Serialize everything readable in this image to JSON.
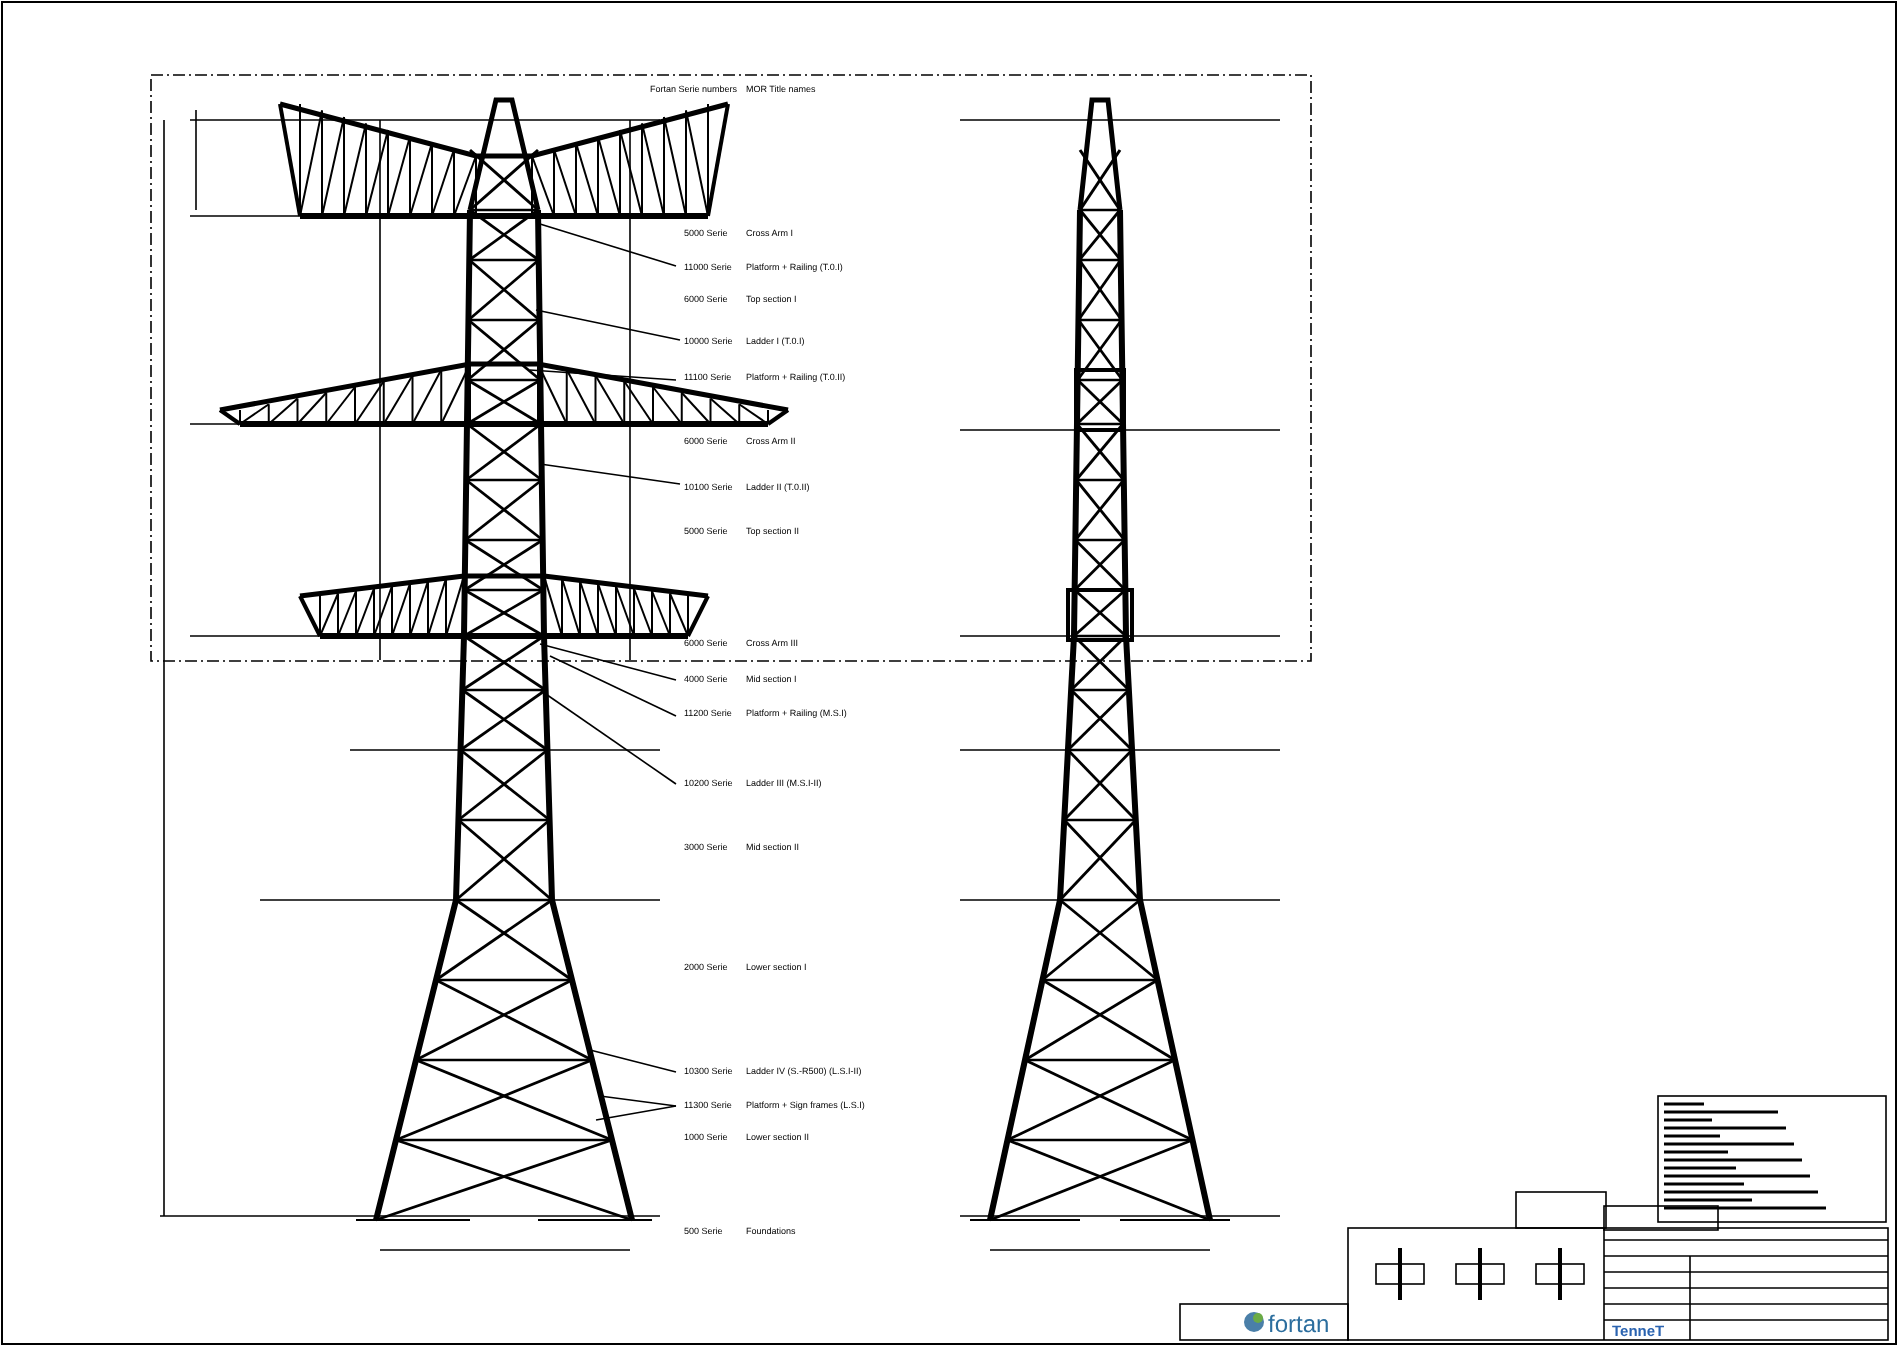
{
  "legend": {
    "headings": [
      "Fortan Serie numbers",
      "MOR Title names"
    ],
    "parts": [
      {
        "serie": "5000 Serie",
        "name": "Cross Arm I"
      },
      {
        "serie": "11000 Serie",
        "name": "Platform + Railing (T.0.I)"
      },
      {
        "serie": "6000 Serie",
        "name": "Top section I"
      },
      {
        "serie": "10000 Serie",
        "name": "Ladder I (T.0.I)"
      },
      {
        "serie": "11100 Serie",
        "name": "Platform + Railing (T.0.II)"
      },
      {
        "serie": "6000 Serie",
        "name": "Cross Arm II"
      },
      {
        "serie": "10100 Serie",
        "name": "Ladder II (T.0.II)"
      },
      {
        "serie": "5000 Serie",
        "name": "Top section II"
      },
      {
        "serie": "6000 Serie",
        "name": "Cross Arm III"
      },
      {
        "serie": "4000 Serie",
        "name": "Mid section I"
      },
      {
        "serie": "11200 Serie",
        "name": "Platform + Railing (M.S.I)"
      },
      {
        "serie": "10200 Serie",
        "name": "Ladder III (M.S.I-II)"
      },
      {
        "serie": "3000 Serie",
        "name": "Mid section II"
      },
      {
        "serie": "2000 Serie",
        "name": "Lower section I"
      },
      {
        "serie": "10300 Serie",
        "name": "Ladder IV (S.-R500) (L.S.I-II)"
      },
      {
        "serie": "11300 Serie",
        "name": "Platform + Sign frames (L.S.I)"
      },
      {
        "serie": "1000 Serie",
        "name": "Lower section II"
      },
      {
        "serie": "500 Serie",
        "name": "Foundations"
      }
    ]
  },
  "logos": {
    "contractor": "fortan",
    "client": "TenneT"
  }
}
